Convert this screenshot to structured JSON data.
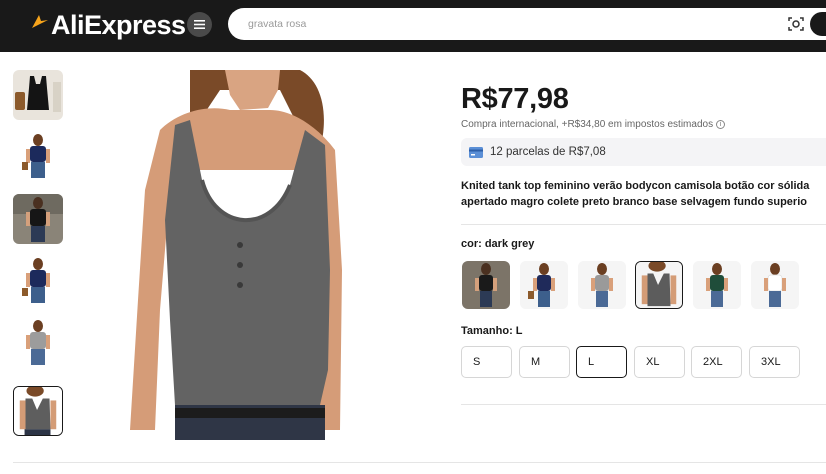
{
  "header": {
    "logo_text": "AliExpress",
    "search_placeholder": "gravata rosa",
    "icons": {
      "menu": "hamburger-menu-icon",
      "camera": "image-search-icon"
    },
    "colors": {
      "bar": "#191919",
      "logo_star": "#f7a41b"
    }
  },
  "gallery": {
    "thumbnails": [
      {
        "name": "black-tank-flatlay"
      },
      {
        "name": "navy-tank-model"
      },
      {
        "name": "black-tank-model"
      },
      {
        "name": "navy-tank-model-2"
      },
      {
        "name": "grey-tank-model"
      },
      {
        "name": "dark-grey-tank-model",
        "selected": true
      }
    ],
    "main_image": "dark-grey-tank-top"
  },
  "product": {
    "price": "R$77,98",
    "tax_note": "Compra internacional, +R$34,80 em impostos estimados",
    "installments": "12 parcelas de R$7,08",
    "title_line1": "Knited tank top feminino verão bodycon camisola botão cor sólida",
    "title_line2": "apertado magro colete preto branco base selvagem fundo superio",
    "color_label": "cor: dark grey",
    "color_options": [
      {
        "name": "black",
        "hex": "#1a1a1a"
      },
      {
        "name": "navy",
        "hex": "#1f2a5a"
      },
      {
        "name": "light-grey",
        "hex": "#9a9a9a"
      },
      {
        "name": "dark-grey",
        "hex": "#5c5c5c",
        "selected": true
      },
      {
        "name": "dark-green",
        "hex": "#1f4d3a"
      },
      {
        "name": "white",
        "hex": "#f2f2f2"
      }
    ],
    "size_label": "Tamanho: L",
    "sizes": [
      "S",
      "M",
      "L",
      "XL",
      "2XL",
      "3XL"
    ],
    "selected_size": "L"
  }
}
